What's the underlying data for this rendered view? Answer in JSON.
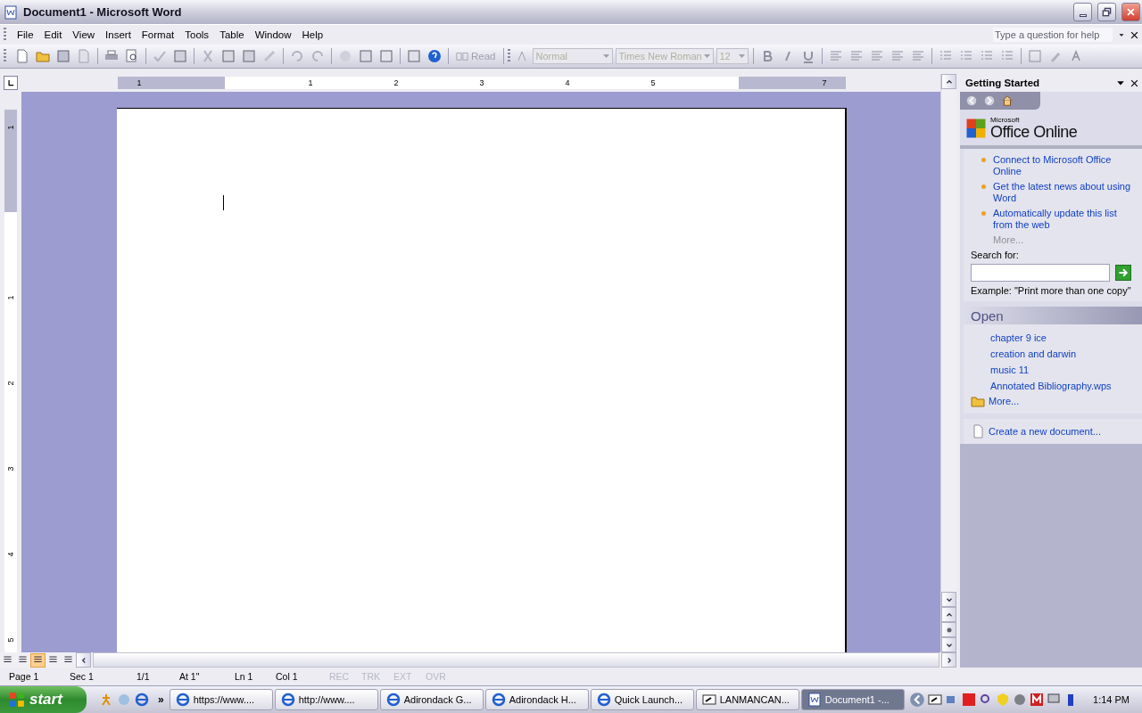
{
  "window": {
    "title": "Document1 - Microsoft Word"
  },
  "menu": [
    "File",
    "Edit",
    "View",
    "Insert",
    "Format",
    "Tools",
    "Table",
    "Window",
    "Help"
  ],
  "help_box": {
    "placeholder": "Type a question for help"
  },
  "toolbar": {
    "read_button": {
      "label": "Read",
      "disabled": true
    },
    "style": {
      "value": "Normal",
      "disabled": true
    },
    "font": {
      "value": "Times New Roman",
      "disabled": true
    },
    "size": {
      "value": "12",
      "disabled": true
    }
  },
  "ruler": {
    "labels": [
      "1",
      "1",
      "2",
      "3",
      "4",
      "5",
      "7"
    ]
  },
  "vertical_ruler": {
    "labels": [
      "1",
      "1",
      "2",
      "3",
      "4",
      "5"
    ]
  },
  "view_buttons": [
    {
      "selected": false
    },
    {
      "selected": false
    },
    {
      "selected": true
    },
    {
      "selected": false
    },
    {
      "selected": false
    }
  ],
  "task_pane": {
    "title": "Getting Started",
    "logo_small": "Microsoft",
    "logo": "Office Online",
    "links": [
      "Connect to Microsoft Office Online",
      "Get the latest news about using Word",
      "Automatically update this list from the web"
    ],
    "more": {
      "label": "More...",
      "disabled": true
    },
    "search_label": "Search for:",
    "example": "Example:  \"Print more than one copy\"",
    "open_header": "Open",
    "files": [
      "chapter 9 ice",
      "creation and darwin",
      "music 11",
      "Annotated Bibliography.wps"
    ],
    "files_more": "More...",
    "create": "Create a new document..."
  },
  "status_bar": [
    {
      "text": "Page  1",
      "disabled": false
    },
    {
      "text": "Sec  1",
      "disabled": false
    },
    {
      "text": "1/1",
      "disabled": false
    },
    {
      "text": "At  1\"",
      "disabled": false
    },
    {
      "text": "Ln  1",
      "disabled": false
    },
    {
      "text": "Col  1",
      "disabled": false
    },
    {
      "text": "REC",
      "disabled": true
    },
    {
      "text": "TRK",
      "disabled": true
    },
    {
      "text": "EXT",
      "disabled": true
    },
    {
      "text": "OVR",
      "disabled": true
    }
  ],
  "taskbar": {
    "start": "start",
    "chevron": "»",
    "tasks": [
      {
        "label": "https://www....",
        "kind": "browser",
        "selected": false
      },
      {
        "label": "http://www....",
        "kind": "browser",
        "selected": false
      },
      {
        "label": "Adirondack G...",
        "kind": "browser",
        "selected": false
      },
      {
        "label": "Adirondack H...",
        "kind": "browser",
        "selected": false
      },
      {
        "label": "Quick Launch...",
        "kind": "browser",
        "selected": false
      },
      {
        "label": "LANMANCAN...",
        "kind": "terminal",
        "selected": false
      },
      {
        "label": "Document1 -...",
        "kind": "word",
        "selected": true
      }
    ],
    "clock": "1:14 PM"
  }
}
